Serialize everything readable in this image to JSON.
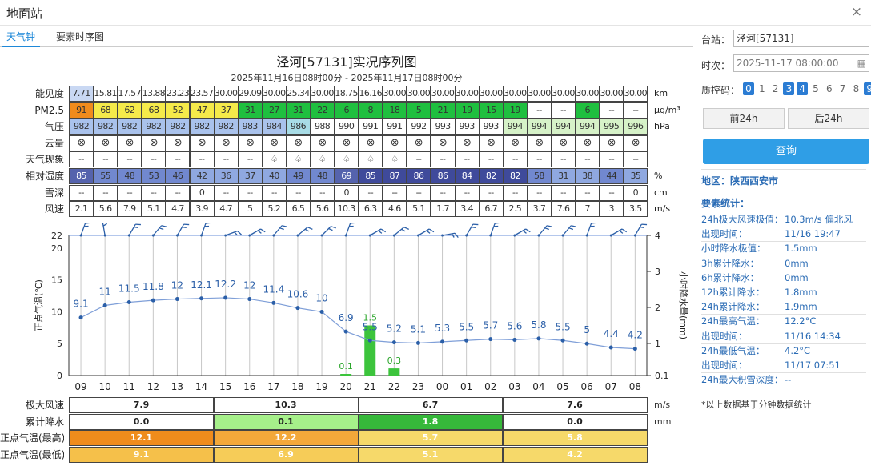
{
  "window": {
    "title": "地面站",
    "close": "×"
  },
  "tabs": [
    {
      "label": "天气钟",
      "active": true
    },
    {
      "label": "要素时序图",
      "active": false
    }
  ],
  "chart_title": "泾河[57131]实况序列图",
  "chart_subtitle": "2025年11月16日08时00分 - 2025年11月17日08时00分",
  "hours": [
    "09",
    "10",
    "11",
    "12",
    "13",
    "14",
    "15",
    "16",
    "17",
    "18",
    "19",
    "20",
    "21",
    "22",
    "23",
    "00",
    "01",
    "02",
    "03",
    "04",
    "05",
    "06",
    "07",
    "08"
  ],
  "rows": [
    {
      "label": "能见度",
      "unit": "km",
      "values": [
        "7.71",
        "15.81",
        "17.57",
        "13.88",
        "23.23",
        "23.57",
        "30.00",
        "29.09",
        "30.00",
        "25.34",
        "30.00",
        "18.75",
        "16.16",
        "30.00",
        "30.00",
        "30.00",
        "30.00",
        "30.00",
        "30.00",
        "30.00",
        "30.00",
        "30.00",
        "30.00",
        "30.00"
      ],
      "colors": [
        "#c9d8f3",
        "#fff",
        "#fff",
        "#fff",
        "#fff",
        "#fff",
        "#fff",
        "#fff",
        "#fff",
        "#fff",
        "#fff",
        "#fff",
        "#fff",
        "#fff",
        "#fff",
        "#fff",
        "#fff",
        "#fff",
        "#fff",
        "#fff",
        "#fff",
        "#fff",
        "#fff",
        "#fff"
      ]
    },
    {
      "label": "PM2.5",
      "unit": "μg/m³",
      "values": [
        "91",
        "68",
        "62",
        "68",
        "52",
        "47",
        "37",
        "31",
        "27",
        "31",
        "22",
        "6",
        "8",
        "18",
        "5",
        "21",
        "19",
        "15",
        "19",
        "--",
        "--",
        "6",
        "--",
        "--"
      ],
      "colors": [
        "#f08b1c",
        "#f5ea4a",
        "#f5ea4a",
        "#f5ea4a",
        "#f5ea4a",
        "#f5ea4a",
        "#f5ea4a",
        "#1fbf3f",
        "#1fbf3f",
        "#1fbf3f",
        "#1fbf3f",
        "#1fbf3f",
        "#1fbf3f",
        "#1fbf3f",
        "#1fbf3f",
        "#1fbf3f",
        "#1fbf3f",
        "#1fbf3f",
        "#1fbf3f",
        "#fff",
        "#fff",
        "#1fbf3f",
        "#fff",
        "#fff"
      ]
    },
    {
      "label": "气压",
      "unit": "hPa",
      "values": [
        "982",
        "982",
        "982",
        "982",
        "982",
        "982",
        "982",
        "983",
        "984",
        "986",
        "988",
        "990",
        "991",
        "991",
        "992",
        "993",
        "993",
        "993",
        "994",
        "994",
        "994",
        "994",
        "995",
        "996"
      ],
      "colors": [
        "#a9c2ec",
        "#a9c2ec",
        "#a9c2ec",
        "#a9c2ec",
        "#a9c2ec",
        "#a9c2ec",
        "#a9c2ec",
        "#a9c2ec",
        "#a9c2ec",
        "#a8dce6",
        "#fff",
        "#fff",
        "#fff",
        "#fff",
        "#fff",
        "#fff",
        "#fff",
        "#fff",
        "#d6f2c8",
        "#d6f2c8",
        "#d6f2c8",
        "#d6f2c8",
        "#d6f2c8",
        "#d6f2c8"
      ]
    },
    {
      "label": "云量",
      "unit": "",
      "values": [
        "⊗",
        "⊗",
        "⊗",
        "⊗",
        "⊗",
        "⊗",
        "⊗",
        "⊗",
        "⊗",
        "⊗",
        "⊗",
        "⊗",
        "⊗",
        "⊗",
        "⊗",
        "⊗",
        "⊗",
        "⊗",
        "⊗",
        "⊗",
        "⊗",
        "⊗",
        "⊗",
        "⊗"
      ],
      "colors": []
    },
    {
      "label": "天气现象",
      "unit": "",
      "values": [
        "--",
        "--",
        "--",
        "--",
        "--",
        "--",
        "--",
        "--",
        "♤",
        "♤",
        "♤",
        "♤",
        "♤",
        "♤",
        "--",
        "--",
        "--",
        "--",
        "--",
        "--",
        "--",
        "--",
        "--",
        "--"
      ],
      "colors": []
    },
    {
      "label": "相对湿度",
      "unit": "%",
      "values": [
        "85",
        "55",
        "48",
        "53",
        "46",
        "42",
        "36",
        "37",
        "40",
        "49",
        "48",
        "69",
        "85",
        "87",
        "86",
        "86",
        "84",
        "82",
        "82",
        "58",
        "31",
        "38",
        "44",
        "35"
      ],
      "colors": [
        "#5563ad",
        "#7188cf",
        "#7188cf",
        "#7188cf",
        "#7188cf",
        "#8fa8e0",
        "#8fa8e0",
        "#8fa8e0",
        "#8fa8e0",
        "#7188cf",
        "#7188cf",
        "#5563ad",
        "#3f4a9b",
        "#3f4a9b",
        "#3f4a9b",
        "#3f4a9b",
        "#3f4a9b",
        "#3f4a9b",
        "#3f4a9b",
        "#7188cf",
        "#8fa8e0",
        "#8fa8e0",
        "#7188cf",
        "#8fa8e0"
      ]
    },
    {
      "label": "雪深",
      "unit": "cm",
      "values": [
        "--",
        "--",
        "--",
        "--",
        "--",
        "0",
        "--",
        "--",
        "--",
        "--",
        "--",
        "0",
        "--",
        "--",
        "--",
        "--",
        "--",
        "--",
        "--",
        "--",
        "--",
        "--",
        "--",
        "0"
      ],
      "colors": []
    },
    {
      "label": "风速",
      "unit": "m/s",
      "values": [
        "2.1",
        "5.6",
        "7.9",
        "5.1",
        "4.7",
        "3.9",
        "4.7",
        "5",
        "5.2",
        "6.5",
        "5.6",
        "10.3",
        "6.3",
        "4.6",
        "5.1",
        "1.7",
        "3.4",
        "6.7",
        "2.5",
        "3.7",
        "7.6",
        "7",
        "3",
        "3.5"
      ],
      "colors": []
    }
  ],
  "chart_data": {
    "type": "line",
    "x": [
      "09",
      "10",
      "11",
      "12",
      "13",
      "14",
      "15",
      "16",
      "17",
      "18",
      "19",
      "20",
      "21",
      "22",
      "23",
      "00",
      "01",
      "02",
      "03",
      "04",
      "05",
      "06",
      "07",
      "08"
    ],
    "series": [
      {
        "name": "",
        "values": [
          9.1,
          11,
          11.5,
          11.8,
          12,
          12.1,
          12.2,
          12,
          11.4,
          10.6,
          10,
          6.9,
          5.5,
          5.2,
          5.1,
          5.3,
          5.5,
          5.7,
          5.6,
          5.8,
          5.5,
          5,
          4.4,
          4.2
        ]
      }
    ],
    "bars": {
      "name": "",
      "values": [
        null,
        null,
        null,
        null,
        null,
        null,
        null,
        null,
        null,
        null,
        null,
        0.1,
        1.5,
        0.3,
        null,
        null,
        null,
        null,
        null,
        null,
        null,
        null,
        null,
        null
      ]
    },
    "ylabel": "正点气温(℃)",
    "y2label": "小时降水量(mm)",
    "ylim": [
      0,
      22
    ],
    "yticks": [
      "0",
      "5",
      "10",
      "15",
      "20",
      "22"
    ],
    "y2ticks": [
      "0.1",
      "1",
      "2",
      "3",
      "4"
    ],
    "color_line": "#2b5fa8",
    "color_bar": "#3cc43c"
  },
  "summary": [
    {
      "label": "极大风速",
      "unit": "m/s",
      "values": [
        "7.9",
        "10.3",
        "6.7",
        "7.6"
      ],
      "colors": [
        "#fff",
        "#fff",
        "#fff",
        "#fff"
      ]
    },
    {
      "label": "累计降水",
      "unit": "mm",
      "values": [
        "0.0",
        "0.1",
        "1.8",
        "0.0"
      ],
      "colors": [
        "#fff",
        "#a6f08a",
        "#36b83a",
        "#fff"
      ]
    },
    {
      "label": "正点气温(最高)",
      "unit": "",
      "values": [
        "12.1",
        "12.2",
        "5.7",
        "5.8"
      ],
      "colors": [
        "#ef8c1c",
        "#f3a83a",
        "#f6d96a",
        "#f6d96a"
      ]
    },
    {
      "label": "正点气温(最低)",
      "unit": "",
      "values": [
        "9.1",
        "6.9",
        "5.1",
        "4.2"
      ],
      "colors": [
        "#f5c04a",
        "#f6cc58",
        "#f6d96a",
        "#f6d96a"
      ]
    }
  ],
  "sidebar": {
    "station_label": "台站：",
    "station_value": "泾河[57131]",
    "time_label": "时次：",
    "time_value": "2025-11-17 08:00:00",
    "qc_label": "质控码：",
    "qc_codes": [
      "0",
      "1",
      "2",
      "3",
      "4",
      "5",
      "6",
      "7",
      "8",
      "9"
    ],
    "qc_selected": [
      "0",
      "3",
      "4",
      "9"
    ],
    "prev_btn": "前24h",
    "next_btn": "后24h",
    "query_btn": "查询",
    "region": "地区：陕西西安市",
    "stats_title": "要素统计：",
    "stats": [
      {
        "label": "24h极大风速极值：",
        "value": "10.3m/s 偏北风"
      },
      {
        "label": "出现时间：",
        "value": "11/16 19:47"
      },
      {
        "label": "小时降水极值：",
        "value": "1.5mm"
      },
      {
        "label": "3h累计降水：",
        "value": "0mm"
      },
      {
        "label": "6h累计降水：",
        "value": "0mm"
      },
      {
        "label": "12h累计降水：",
        "value": "1.8mm"
      },
      {
        "label": "24h累计降水：",
        "value": "1.9mm"
      },
      {
        "label": "24h最高气温：",
        "value": "12.2°C"
      },
      {
        "label": "出现时间：",
        "value": "11/16 14:34"
      },
      {
        "label": "24h最低气温：",
        "value": "4.2°C"
      },
      {
        "label": "出现时间：",
        "value": "11/17 07:51"
      },
      {
        "label": "24h最大积雪深度：",
        "value": "--"
      }
    ],
    "note": "*以上数据基于分钟数据统计"
  }
}
